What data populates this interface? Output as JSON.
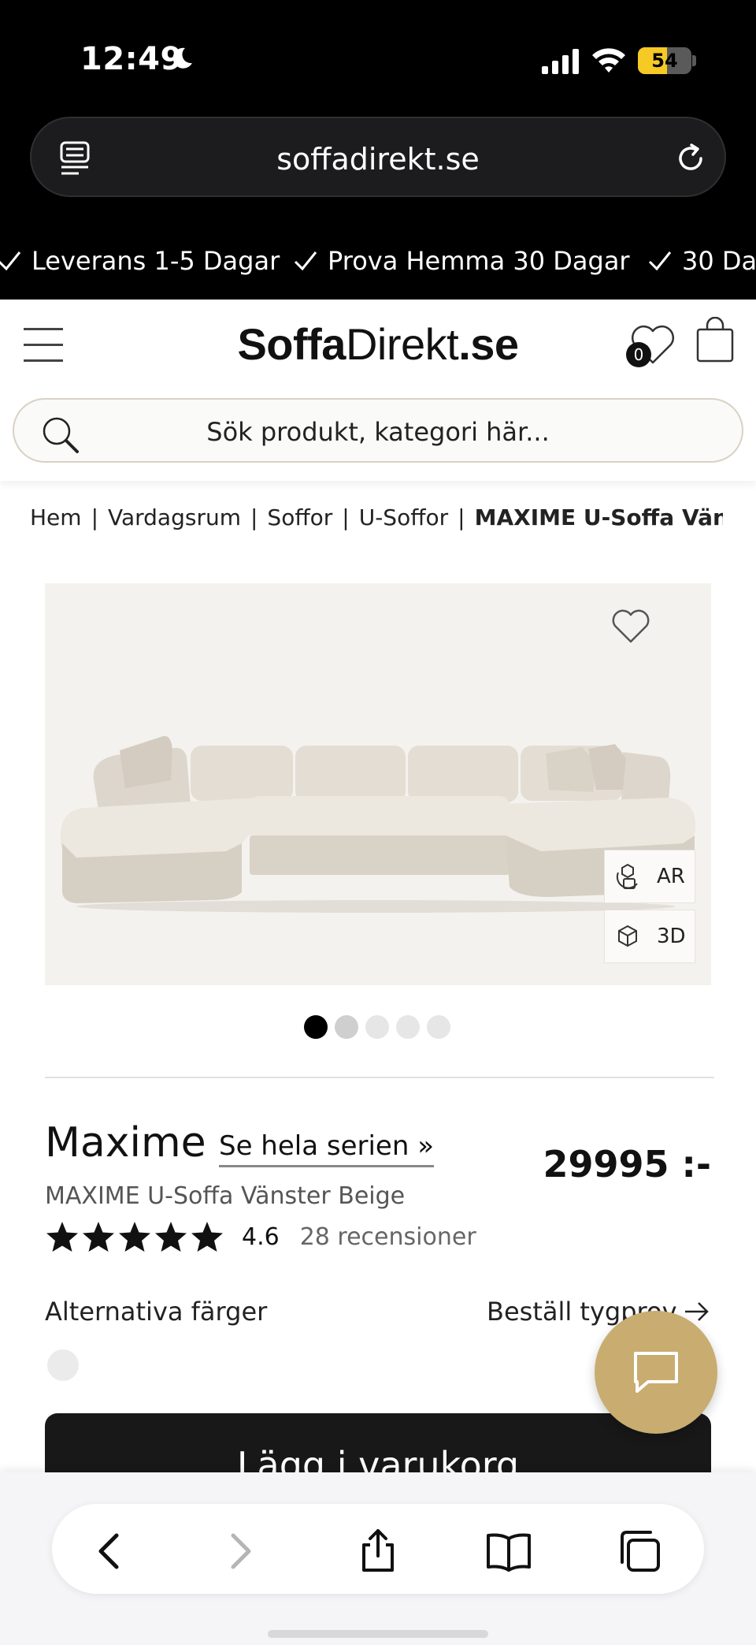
{
  "status_bar": {
    "time": "12:49",
    "battery": "54"
  },
  "browser": {
    "url": "soffadirekt.se"
  },
  "usp": [
    "Leverans 1-5 Dagar",
    "Prova Hemma 30 Dagar",
    "30 Da"
  ],
  "header": {
    "logo_bold": "Soffa",
    "logo_mid": "Direkt",
    "logo_end": ".se",
    "wishlist_count": "0"
  },
  "search": {
    "placeholder": "Sök produkt, kategori här..."
  },
  "breadcrumb": {
    "items": [
      "Hem",
      "Vardagsrum",
      "Soffor",
      "U-Soffor"
    ],
    "separator": "|",
    "current": "MAXIME U-Soffa Väns"
  },
  "gallery": {
    "ar_label": "AR",
    "view3d_label": "3D",
    "image_count": 5,
    "active_index": 0
  },
  "product": {
    "name": "Maxime",
    "series_link": "Se hela serien »",
    "price": "29995 :-",
    "subtitle": "MAXIME U-Soffa Vänster Beige",
    "rating_value": "4.6",
    "rating_stars": 5,
    "reviews": "28 recensioner",
    "alt_colors_label": "Alternativa färger",
    "order_sample_label": "Beställ tygprov",
    "add_to_cart": "Lägg i varukorg"
  },
  "colors": {
    "brand_black": "#181818",
    "chat_gold": "#c9ac70",
    "battery_yellow": "#f6c925"
  }
}
